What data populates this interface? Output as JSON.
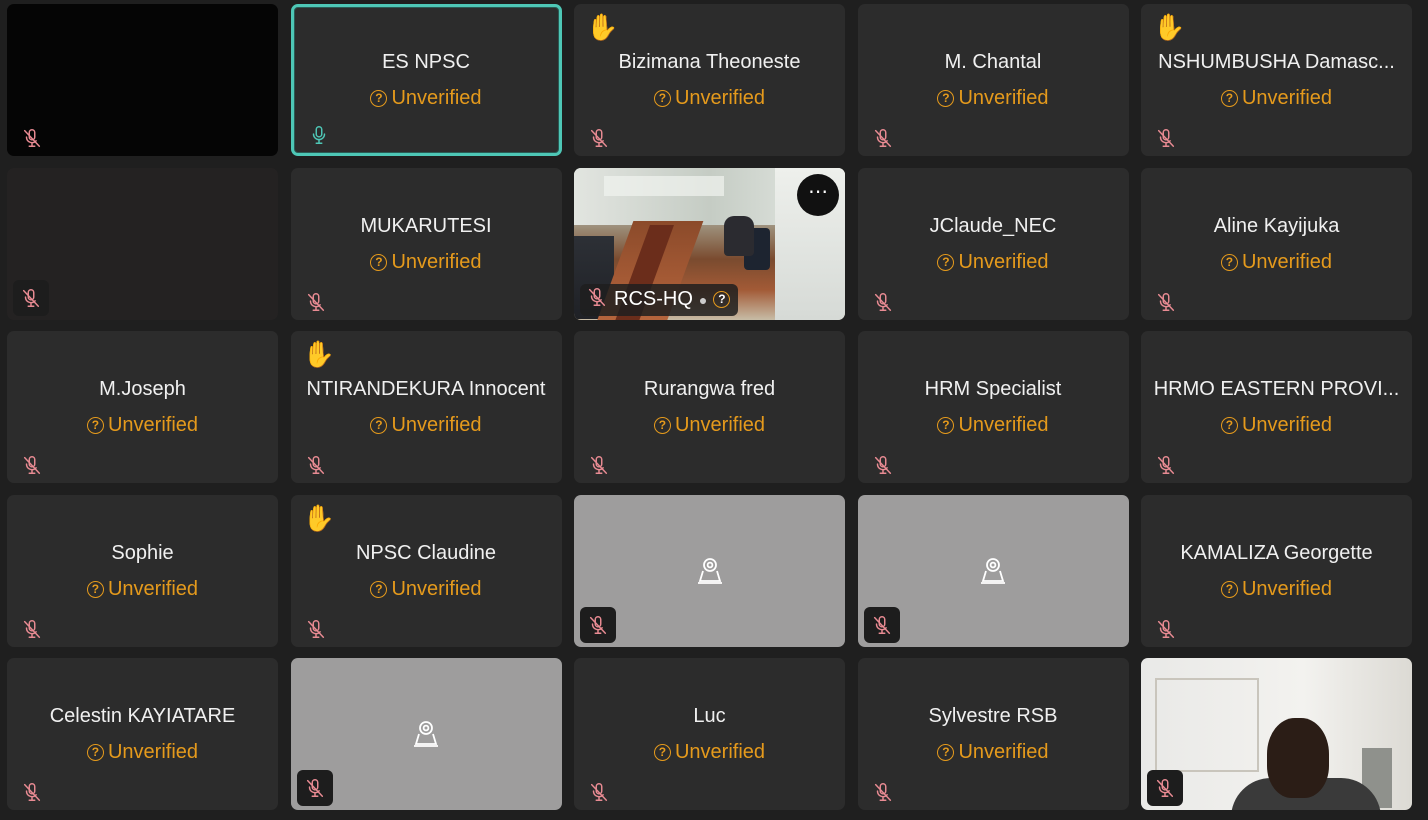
{
  "app": {
    "accent": "#4ec7b6",
    "status_color": "#e59a1c",
    "muted_icon_color": "#e98b93"
  },
  "tiles": [
    {
      "type": "blank",
      "name": "",
      "status": "",
      "muted": true,
      "hand": false,
      "icon": "mic-off-icon"
    },
    {
      "type": "name",
      "name": "ES NPSC",
      "status": "Unverified",
      "muted": false,
      "hand": false,
      "active": true,
      "icon": "mic-on-icon"
    },
    {
      "type": "name",
      "name": "Bizimana Theoneste",
      "status": "Unverified",
      "muted": true,
      "hand": true
    },
    {
      "type": "name",
      "name": "M. Chantal",
      "status": "Unverified",
      "muted": true,
      "hand": false
    },
    {
      "type": "name",
      "name": "NSHUMBUSHA Damasc...",
      "status": "Unverified",
      "muted": true,
      "hand": true
    },
    {
      "type": "blank-dark",
      "name": "",
      "status": "",
      "muted": true,
      "hand": false
    },
    {
      "type": "name",
      "name": "MUKARUTESI",
      "status": "Unverified",
      "muted": true,
      "hand": false
    },
    {
      "type": "video-room",
      "name": "RCS-HQ",
      "status": "",
      "muted": true,
      "hand": false,
      "more": "⋯"
    },
    {
      "type": "name",
      "name": "JClaude_NEC",
      "status": "Unverified",
      "muted": true,
      "hand": false
    },
    {
      "type": "name",
      "name": "Aline Kayijuka",
      "status": "Unverified",
      "muted": true,
      "hand": false
    },
    {
      "type": "name",
      "name": "M.Joseph",
      "status": "Unverified",
      "muted": true,
      "hand": false
    },
    {
      "type": "name",
      "name": "NTIRANDEKURA Innocent",
      "status": "Unverified",
      "muted": true,
      "hand": true
    },
    {
      "type": "name",
      "name": "Rurangwa fred",
      "status": "Unverified",
      "muted": true,
      "hand": false
    },
    {
      "type": "name",
      "name": "HRM Specialist",
      "status": "Unverified",
      "muted": true,
      "hand": false
    },
    {
      "type": "name",
      "name": "HRMO EASTERN PROVI...",
      "status": "Unverified",
      "muted": true,
      "hand": false
    },
    {
      "type": "name",
      "name": "Sophie",
      "status": "Unverified",
      "muted": true,
      "hand": false
    },
    {
      "type": "name",
      "name": "NPSC Claudine",
      "status": "Unverified",
      "muted": true,
      "hand": true
    },
    {
      "type": "camera-off",
      "name": "",
      "status": "",
      "muted": true,
      "hand": false
    },
    {
      "type": "camera-off",
      "name": "",
      "status": "",
      "muted": true,
      "hand": false
    },
    {
      "type": "name",
      "name": "KAMALIZA Georgette",
      "status": "Unverified",
      "muted": true,
      "hand": false
    },
    {
      "type": "name",
      "name": "Celestin KAYIATARE",
      "status": "Unverified",
      "muted": true,
      "hand": false
    },
    {
      "type": "camera-off",
      "name": "",
      "status": "",
      "muted": true,
      "hand": false
    },
    {
      "type": "name",
      "name": "Luc",
      "status": "Unverified",
      "muted": true,
      "hand": false
    },
    {
      "type": "name",
      "name": "Sylvestre RSB",
      "status": "Unverified",
      "muted": true,
      "hand": false
    },
    {
      "type": "video-person",
      "name": "",
      "status": "",
      "muted": true,
      "hand": false
    }
  ],
  "icons": {
    "hand": "✋",
    "question": "?"
  }
}
